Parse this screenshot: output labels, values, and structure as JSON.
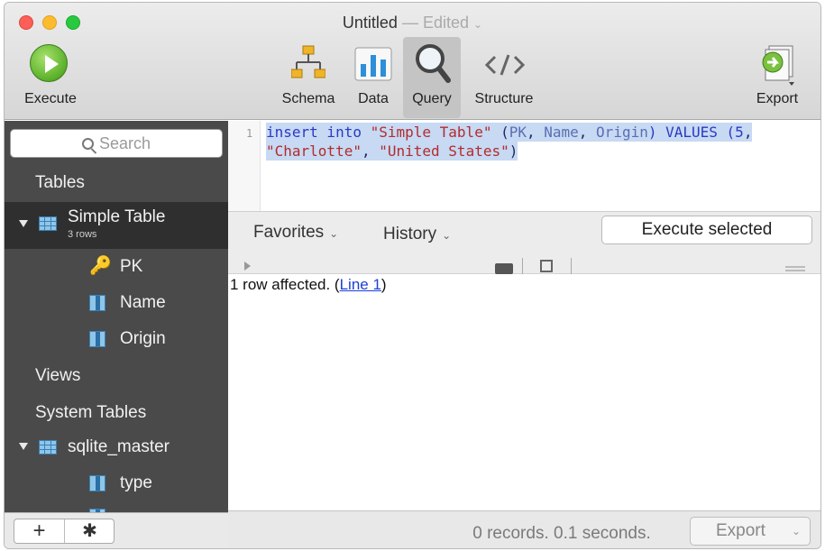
{
  "window": {
    "title": "Untitled",
    "title_separator": "—",
    "title_state": "Edited",
    "title_chevron": "⌄"
  },
  "toolbar": {
    "execute_label": "Execute",
    "schema_label": "Schema",
    "data_label": "Data",
    "query_label": "Query",
    "structure_label": "Structure",
    "export_label": "Export",
    "active_tab": "Query"
  },
  "sidebar": {
    "search_placeholder": "Search",
    "tables_header": "Tables",
    "tables": [
      {
        "name": "Simple Table",
        "subtitle": "3 rows",
        "expanded": true,
        "columns": [
          {
            "name": "PK",
            "icon": "key-icon"
          },
          {
            "name": "Name",
            "icon": "column-icon"
          },
          {
            "name": "Origin",
            "icon": "column-icon"
          }
        ]
      }
    ],
    "views_header": "Views",
    "system_tables_header": "System Tables",
    "system_tables": [
      {
        "name": "sqlite_master",
        "expanded": true,
        "columns": [
          {
            "name": "type",
            "icon": "column-icon"
          }
        ]
      }
    ],
    "bottom": {
      "add_symbol": "+",
      "gear_symbol": "✱"
    }
  },
  "editor": {
    "line_number": "1",
    "code_line1": {
      "p1": "insert into ",
      "p2": "\"Simple Table\"",
      "p3": " (",
      "p4": "PK",
      "p5": ", ",
      "p6": "Name",
      "p7": ", ",
      "p8": "Origin",
      "p9": ") VALUES (",
      "p10": "5",
      "p11": ","
    },
    "code_line2": {
      "p1": "\"Charlotte\"",
      "p2": ", ",
      "p3": "\"United States\"",
      "p4": ")"
    },
    "selection_color": "#c7d9f3"
  },
  "query_bar": {
    "favorites_label": "Favorites",
    "history_label": "History",
    "execute_selected_label": "Execute selected"
  },
  "results": {
    "message_prefix": "1 row affected. (",
    "message_link": "Line 1",
    "message_suffix": ")"
  },
  "status": {
    "text": "0 records. 0.1 seconds.",
    "export_label": "Export"
  },
  "colors": {
    "sidebar_bg": "#4a4a4a",
    "sidebar_selected": "#2f2f2f",
    "keyword": "#2a39c4",
    "string": "#b22c2c",
    "link": "#1a3fd6"
  }
}
